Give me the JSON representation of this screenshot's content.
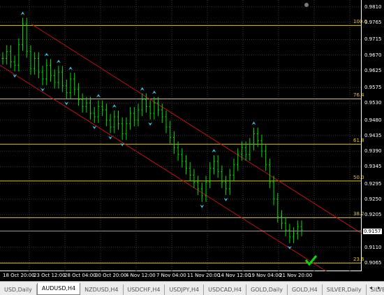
{
  "chart": {
    "symbol": "AUDUSD,H4",
    "colors": {
      "background": "#000000",
      "grid": "#3a3a3a",
      "bars": "#00e000",
      "fib": "#e3c61a",
      "channel": "#c01010",
      "arrows": "#33c9e8",
      "check": "#00dd00"
    },
    "price_labels": [
      "0.9810",
      "0.9765",
      "0.9715",
      "0.9670",
      "0.9625",
      "0.9575",
      "0.9530",
      "0.9480",
      "0.9435",
      "0.9390",
      "0.9345",
      "0.9295",
      "0.9250",
      "0.9205",
      "0.9157",
      "0.9110",
      "0.9065"
    ],
    "current_price": "0.9157",
    "time_labels": [
      "18 Oct 20:00",
      "23 Oct 12:00",
      "28 Oct 04:00",
      "30 Oct 20:00",
      "4 Nov 12:00",
      "7 Nov 04:00",
      "11 Nov 20:00",
      "14 Nov 12:00",
      "19 Nov 04:00",
      "21 Nov 20:00"
    ],
    "fib_levels": [
      {
        "label": "100.0",
        "price": 0.9756
      },
      {
        "label": "76.4",
        "price": 0.9542
      },
      {
        "label": "61.8",
        "price": 0.941
      },
      {
        "label": "50.0",
        "price": 0.9303
      },
      {
        "label": "38.2",
        "price": 0.9196
      },
      {
        "label": "23.6",
        "price": 0.9064
      }
    ]
  },
  "chart_data": {
    "type": "candlestick",
    "ylim": [
      0.904,
      0.983
    ],
    "close_series": [
      0.966,
      0.968,
      0.965,
      0.964,
      0.97,
      0.976,
      0.968,
      0.963,
      0.966,
      0.962,
      0.96,
      0.964,
      0.961,
      0.959,
      0.962,
      0.958,
      0.956,
      0.96,
      0.957,
      0.954,
      0.952,
      0.953,
      0.95,
      0.949,
      0.952,
      0.951,
      0.948,
      0.946,
      0.949,
      0.947,
      0.944,
      0.947,
      0.95,
      0.948,
      0.951,
      0.954,
      0.952,
      0.95,
      0.953,
      0.951,
      0.949,
      0.946,
      0.943,
      0.94,
      0.938,
      0.936,
      0.934,
      0.932,
      0.93,
      0.928,
      0.926,
      0.93,
      0.934,
      0.936,
      0.933,
      0.93,
      0.928,
      0.932,
      0.935,
      0.938,
      0.94,
      0.938,
      0.941,
      0.944,
      0.942,
      0.939,
      0.935,
      0.93,
      0.925,
      0.92,
      0.918,
      0.916,
      0.914,
      0.915,
      0.917,
      0.916
    ]
  },
  "tabs": [
    "USD,Daily",
    "AUDUSD,H4",
    "NZDUSD,H4",
    "USDCHF,H4",
    "USDJPY,H4",
    "USDCAD,H4",
    "GOLD,Daily",
    "GOLD,H4",
    "SILVER,Daily",
    "SILVER,H4",
    "C"
  ],
  "active_tab": "AUDUSD,H4",
  "tab_scroll": {
    "left": "◂",
    "right": "▸"
  }
}
